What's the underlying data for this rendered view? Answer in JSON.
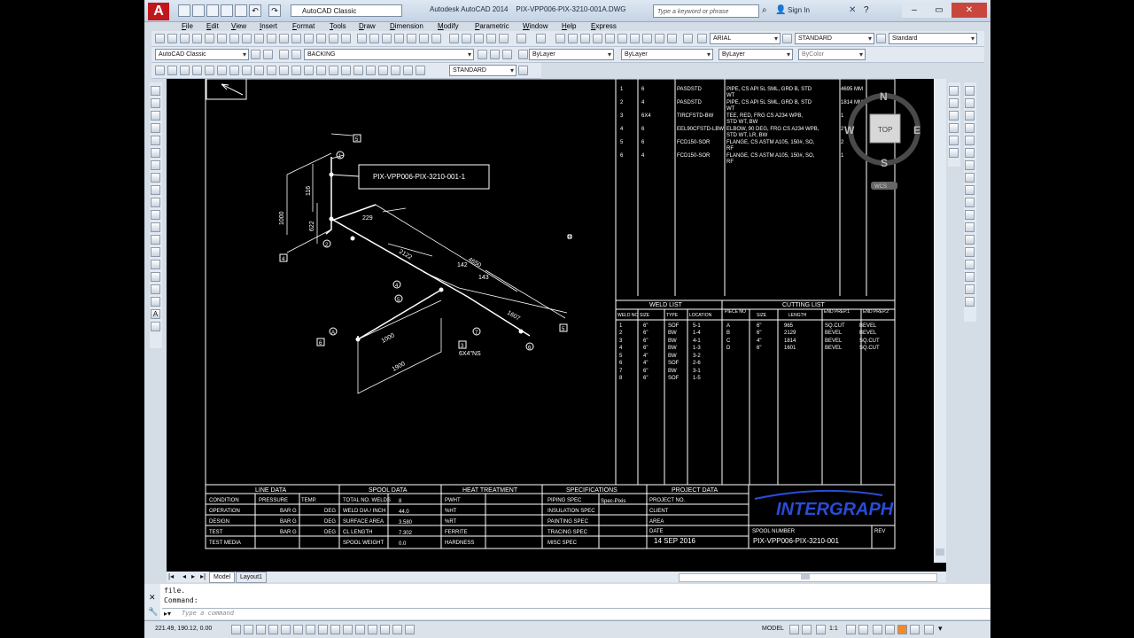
{
  "titlebar": {
    "workspace": "AutoCAD Classic",
    "app": "Autodesk AutoCAD 2014",
    "file": "PIX-VPP006-PIX-3210-001A.DWG",
    "search_placeholder": "Type a keyword or phrase",
    "sign_in": "Sign In"
  },
  "menu": [
    "File",
    "Edit",
    "View",
    "Insert",
    "Format",
    "Tools",
    "Draw",
    "Dimension",
    "Modify",
    "Parametric",
    "Window",
    "Help",
    "Express"
  ],
  "toolbars": {
    "text_style": "ARIAL",
    "dim_style": "STANDARD",
    "table_style": "Standard",
    "workspace": "AutoCAD Classic",
    "layer": "BACKING",
    "color": "ByLayer",
    "linetype": "ByLayer",
    "lineweight": "ByLayer",
    "plotstyle": "ByColor",
    "dim_style2": "STANDARD"
  },
  "viewcube": {
    "n": "N",
    "s": "S",
    "e": "E",
    "w": "W",
    "top": "TOP",
    "wcs": "WCS"
  },
  "drawing": {
    "line_id_callout": "PIX-VPP006-PIX-3210-001-1",
    "dims": {
      "d229": "229",
      "d2122": "2122",
      "d4650": "4650",
      "d142": "142",
      "d143": "143",
      "d1607": "1607",
      "d1000": "1000",
      "d116": "116",
      "d622": "622",
      "d1000b": "1000",
      "d1900": "1900",
      "d6x4": "6X4\"NS"
    },
    "bom_rows": [
      {
        "no": "1",
        "qty": "6",
        "code": "PASDSTD",
        "desc1": "PIPE, CS API 5L SML, GRD B, STD",
        "desc2": "WT",
        "len": "4695 MM"
      },
      {
        "no": "2",
        "qty": "4",
        "code": "PASDSTD",
        "desc1": "PIPE, CS API 5L SML, GRD B, STD",
        "desc2": "WT",
        "len": "1814 MM"
      },
      {
        "no": "3",
        "qty": "6X4",
        "code": "TIRCFSTD-BW",
        "desc1": "TEE, RED, FRG CS A234 WPB,",
        "desc2": "STD WT, BW",
        "len": "1"
      },
      {
        "no": "4",
        "qty": "6",
        "code": "EEL90CFSTD-LBW",
        "desc1": "ELBOW, 90 DEG, FRG CS A234 WPB,",
        "desc2": "STD WT, LR, BW",
        "len": "2"
      },
      {
        "no": "5",
        "qty": "6",
        "code": "FCD150-SOR",
        "desc1": "FLANGE, CS ASTM A105, 150#, SO,",
        "desc2": "RF",
        "len": "2"
      },
      {
        "no": "6",
        "qty": "4",
        "code": "FCD150-SOR",
        "desc1": "FLANGE, CS ASTM A105, 150#, SO,",
        "desc2": "RF",
        "len": "1"
      }
    ],
    "weld_list": {
      "title": "WELD LIST",
      "headers": [
        "WELD NO",
        "SIZE",
        "TYPE",
        "LOCATION"
      ],
      "rows": [
        [
          "1",
          "6\"",
          "SOF",
          "5-1"
        ],
        [
          "2",
          "6\"",
          "BW",
          "1-4"
        ],
        [
          "3",
          "6\"",
          "BW",
          "4-1"
        ],
        [
          "4",
          "6\"",
          "BW",
          "1-3"
        ],
        [
          "5",
          "4\"",
          "BW",
          "3-2"
        ],
        [
          "6",
          "4\"",
          "SOF",
          "2-6"
        ],
        [
          "7",
          "6\"",
          "BW",
          "3-1"
        ],
        [
          "8",
          "6\"",
          "SOF",
          "1-5"
        ]
      ]
    },
    "cutting_list": {
      "title": "CUTTING LIST",
      "headers": [
        "PIECE NO",
        "SIZE",
        "LENGTH",
        "END PREP.1",
        "END PREP.2"
      ],
      "rows": [
        [
          "A",
          "6\"",
          "965",
          "SQ.CUT",
          "BEVEL"
        ],
        [
          "B",
          "6\"",
          "2129",
          "BEVEL",
          "BEVEL"
        ],
        [
          "C",
          "4\"",
          "1814",
          "BEVEL",
          "SQ.CUT"
        ],
        [
          "D",
          "6\"",
          "1601",
          "BEVEL",
          "SQ.CUT"
        ]
      ]
    },
    "title_block": {
      "line_data": "LINE DATA",
      "spool_data": "SPOOL DATA",
      "heat": "HEAT TREATMENT",
      "specs": "SPECIFICATIONS",
      "project": "PROJECT DATA",
      "ld_headers": [
        "CONDITION",
        "PRESSURE",
        "TEMP."
      ],
      "ld_rows": [
        [
          "OPERATION",
          "BAR G",
          "DEG"
        ],
        [
          "DESIGN",
          "BAR G",
          "DEG"
        ],
        [
          "TEST",
          "BAR G",
          "DEG"
        ],
        [
          "TEST MEDIA",
          "",
          ""
        ]
      ],
      "sd_rows": [
        [
          "TOTAL NO. WELDS",
          "8"
        ],
        [
          "WELD DIA / INCH",
          "44.0"
        ],
        [
          "SURFACE AREA",
          "3.580"
        ],
        [
          "CL LENGTH",
          "7.302"
        ],
        [
          "SPOOL WEIGHT",
          "0.0"
        ]
      ],
      "ht_rows": [
        "PWHT",
        "%HT",
        "%RT",
        "FERRITE",
        "HARDNESS"
      ],
      "sp_rows": [
        [
          "PIPING SPEC",
          "Spec-Pixis"
        ],
        [
          "INSULATION SPEC",
          ""
        ],
        [
          "PAINTING SPEC",
          ""
        ],
        [
          "TRACING SPEC",
          ""
        ],
        [
          "MISC SPEC",
          ""
        ]
      ],
      "pd_rows": [
        "PROJECT NO.",
        "CLIENT",
        "AREA"
      ],
      "date_label": "DATE",
      "date": "14 SEP 2016",
      "logo": "INTERGRAPH",
      "spool_label": "SPOOL NUMBER",
      "spool": "PIX-VPP006-PIX-3210-001",
      "rev": "REV"
    }
  },
  "tabs": [
    "Model",
    "Layout1"
  ],
  "command": {
    "history": "file.",
    "prompt": "Command:",
    "placeholder": "Type a command"
  },
  "status": {
    "coords": "221.49, 190.12, 0.00",
    "model": "MODEL",
    "scale": "1:1"
  }
}
